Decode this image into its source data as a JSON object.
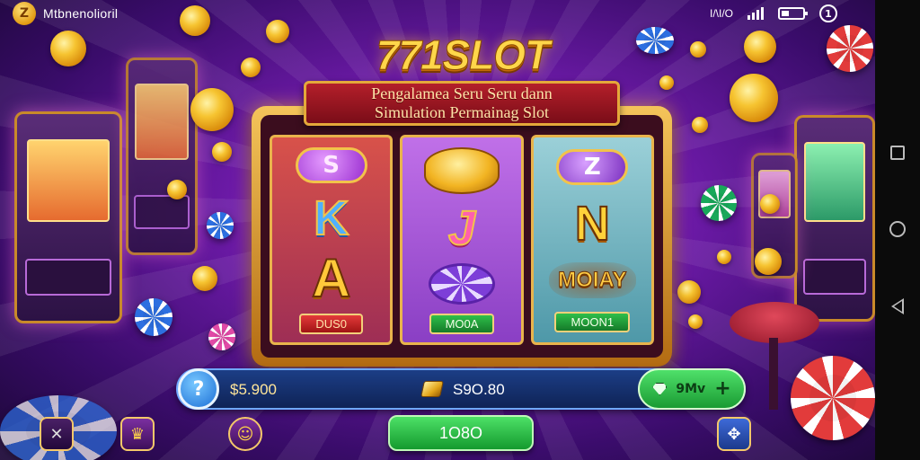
{
  "status_bar": {
    "app_logo_glyph": "Z",
    "app_name": "Mtbnenolioril",
    "status_code": "I/\\I/O"
  },
  "game": {
    "title": "771SLOT",
    "subtitle_line1": "Pengalamea Seru Seru dann",
    "subtitle_line2": "Simulation Permainag Slot"
  },
  "reels": [
    {
      "symbols": [
        {
          "type": "token",
          "text": "S",
          "style": "tok-purple",
          "icon": "s-token-icon"
        },
        {
          "type": "letter",
          "text": "K",
          "style": "sym-k",
          "icon": "k-symbol-icon"
        },
        {
          "type": "letter",
          "text": "A",
          "style": "sym-a",
          "icon": "a-symbol-icon"
        }
      ],
      "label": "DUS0",
      "label_color": "#c01d1d"
    },
    {
      "symbols": [
        {
          "type": "stack",
          "text": "",
          "icon": "coin-stack-icon"
        },
        {
          "type": "letter",
          "text": "J",
          "style": "sym-j",
          "icon": "j-symbol-icon"
        },
        {
          "type": "chip",
          "text": "",
          "icon": "poker-chip-icon"
        }
      ],
      "label": "MO0A",
      "label_color": "#1e9b35"
    },
    {
      "symbols": [
        {
          "type": "token",
          "text": "Z",
          "style": "tok-violet",
          "icon": "z-token-icon"
        },
        {
          "type": "letter",
          "text": "N",
          "style": "sym-n",
          "icon": "n-symbol-icon"
        },
        {
          "type": "word",
          "text": "MOIAY",
          "icon": "moiay-symbol-icon"
        }
      ],
      "label": "MOON1",
      "label_color": "#1e9b35"
    }
  ],
  "bottom_bar": {
    "help_glyph": "?",
    "balance": "$5.900",
    "bet": "S9O.80",
    "add_label": "9Mv",
    "add_glyph": "+"
  },
  "spin_button": {
    "label": "1O8O"
  },
  "small_buttons": [
    {
      "glyph": "✕",
      "icon": "crossed-tools-icon"
    },
    {
      "glyph": "♛",
      "icon": "treasure-icon"
    },
    {
      "glyph": "☺",
      "icon": "character-icon"
    },
    {
      "glyph": "✥",
      "icon": "puzzle-icon"
    }
  ],
  "colors": {
    "background_primary": "#6c1aa7",
    "title_gold": "#ffd64a",
    "banner_red": "#b41f2a",
    "accent_green": "#2fbf4a",
    "bar_blue": "#1c3e86"
  }
}
